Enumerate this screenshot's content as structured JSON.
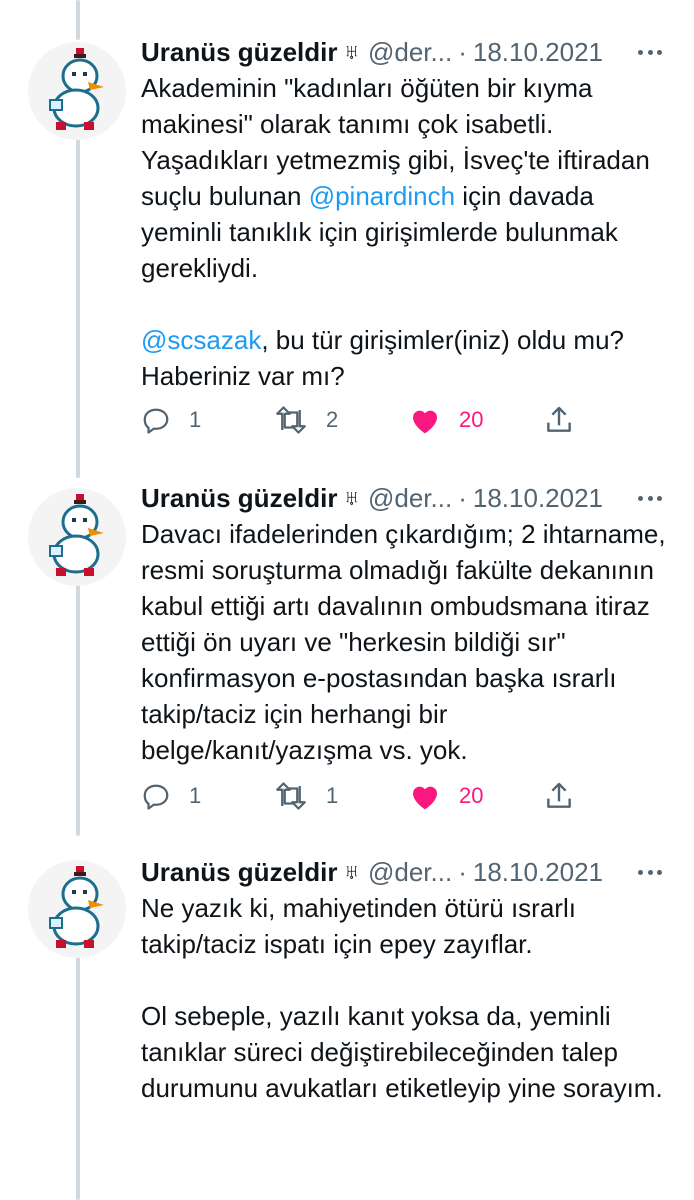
{
  "tweets": [
    {
      "author": "Uranüs güzeldir",
      "icon": "♅",
      "handle": "@der...",
      "date": "18.10.2021",
      "p1_a": "Akademinin \"kadınları öğüten bir kıyma makinesi\" olarak tanımı çok isabetli. Yaşadıkları yetmezmiş gibi, İsveç'te iftiradan suçlu bulunan ",
      "p1_mention": "@pinardinch",
      "p1_b": " için davada yeminli tanıklık için girişimlerde bulunmak gerekliydi.",
      "p2_mention": "@scsazak",
      "p2_b": ", bu tür girişimler(iniz) oldu mu? Haberiniz var mı?",
      "replies": "1",
      "retweets": "2",
      "likes": "20"
    },
    {
      "author": "Uranüs güzeldir",
      "icon": "♅",
      "handle": "@der...",
      "date": "18.10.2021",
      "text": "Davacı ifadelerinden çıkardığım; 2 ihtarname, resmi soruşturma olmadığı fakülte dekanının kabul ettiği artı davalının ombudsmana itiraz ettiği ön uyarı ve \"herkesin bildiği sır\" konfirmasyon e-postasından başka ısrarlı takip/taciz için herhangi bir belge/kanıt/yazışma vs. yok.",
      "replies": "1",
      "retweets": "1",
      "likes": "20"
    },
    {
      "author": "Uranüs güzeldir",
      "icon": "♅",
      "handle": "@der...",
      "date": "18.10.2021",
      "p1": "Ne yazık ki, mahiyetinden ötürü ısrarlı takip/taciz ispatı için epey zayıflar.",
      "p2": "Ol sebeple, yazılı kanıt yoksa da, yeminli tanıklar süreci değiştirebileceğinden talep durumunu avukatları etiketleyip yine sorayım."
    }
  ],
  "colors": {
    "accent": "#1d9bf0",
    "like": "#f91880",
    "muted": "#536471",
    "thread_line": "#cfd9de"
  }
}
